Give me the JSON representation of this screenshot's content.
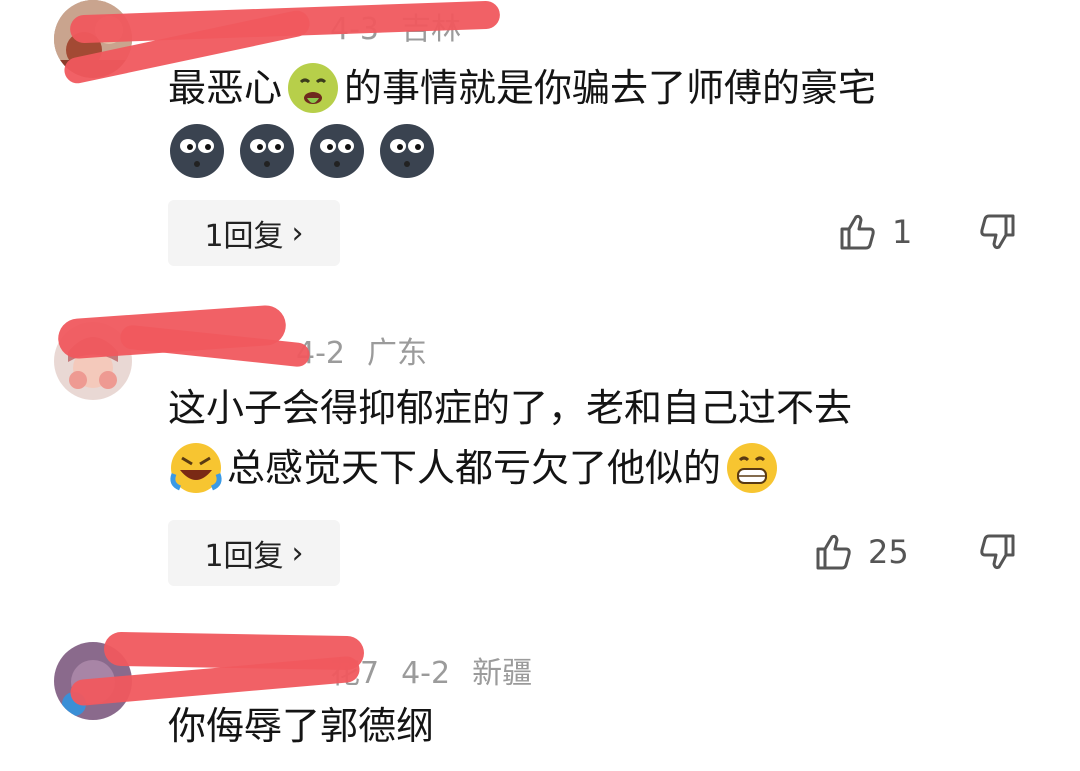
{
  "comments": [
    {
      "location": "吉林",
      "date": "4-3",
      "text_line1_a": "最恶心",
      "text_line1_b": "的事情就是你骗去了师傅的豪宅",
      "emojis": [
        "sick-face-emoji",
        "moon-face-emoji",
        "moon-face-emoji",
        "moon-face-emoji",
        "moon-face-emoji"
      ],
      "reply_label": "1回复",
      "likes": "1"
    },
    {
      "location": "广东",
      "date": "4-2",
      "text_line1": "这小子会得抑郁症的了，老和自己过不去",
      "text_line2": "总感觉天下人都亏欠了他似的",
      "emojis": [
        "rolling-laugh-emoji",
        "grin-emoji"
      ],
      "reply_label": "1回复",
      "likes": "25"
    },
    {
      "name_suffix": "花7",
      "location": "新疆",
      "date": "4-2",
      "text_line1": "你侮辱了郭德纲"
    }
  ],
  "colors": {
    "redaction": "#f0585e",
    "meta_text": "#9b9b9b",
    "reply_bg": "#f4f4f4"
  }
}
